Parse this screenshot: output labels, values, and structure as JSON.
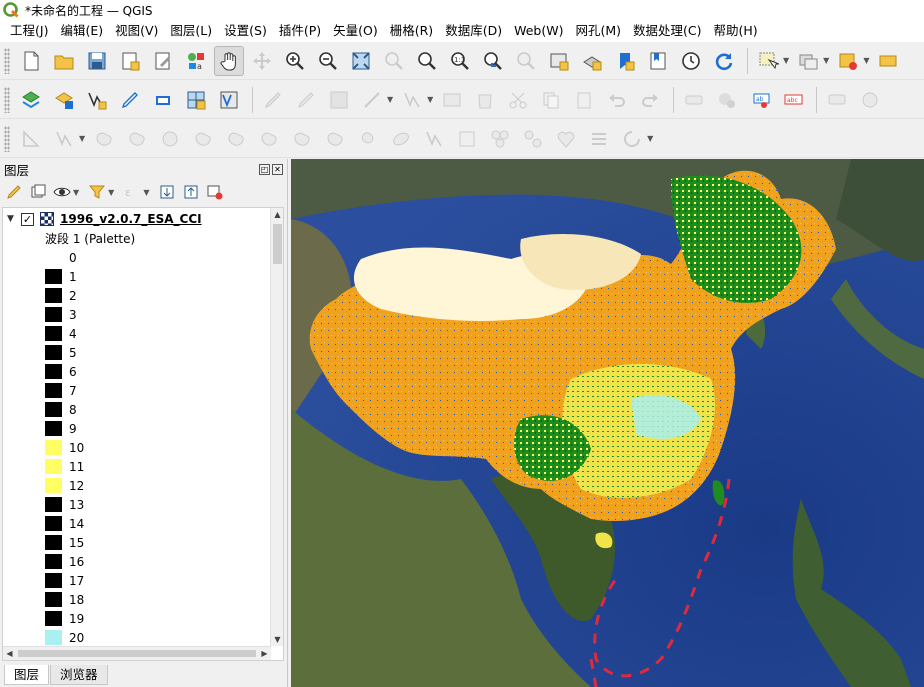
{
  "window": {
    "title": "*未命名的工程 — QGIS"
  },
  "menubar": {
    "items": [
      "工程(J)",
      "编辑(E)",
      "视图(V)",
      "图层(L)",
      "设置(S)",
      "插件(P)",
      "矢量(O)",
      "栅格(R)",
      "数据库(D)",
      "Web(W)",
      "网孔(M)",
      "数据处理(C)",
      "帮助(H)"
    ]
  },
  "layers_panel": {
    "title": "图层",
    "layer": {
      "name": "1996_v2.0.7_ESA_CCI",
      "checked": "✓",
      "expand": "▼"
    },
    "band_label": "波段 1 (Palette)",
    "legend": [
      {
        "value": "0",
        "color": "#ffffff"
      },
      {
        "value": "1",
        "color": "#000000"
      },
      {
        "value": "2",
        "color": "#000000"
      },
      {
        "value": "3",
        "color": "#000000"
      },
      {
        "value": "4",
        "color": "#000000"
      },
      {
        "value": "5",
        "color": "#000000"
      },
      {
        "value": "6",
        "color": "#000000"
      },
      {
        "value": "7",
        "color": "#000000"
      },
      {
        "value": "8",
        "color": "#000000"
      },
      {
        "value": "9",
        "color": "#000000"
      },
      {
        "value": "10",
        "color": "#ffff64"
      },
      {
        "value": "11",
        "color": "#ffff64"
      },
      {
        "value": "12",
        "color": "#ffff64"
      },
      {
        "value": "13",
        "color": "#000000"
      },
      {
        "value": "14",
        "color": "#000000"
      },
      {
        "value": "15",
        "color": "#000000"
      },
      {
        "value": "16",
        "color": "#000000"
      },
      {
        "value": "17",
        "color": "#000000"
      },
      {
        "value": "18",
        "color": "#000000"
      },
      {
        "value": "19",
        "color": "#000000"
      },
      {
        "value": "20",
        "color": "#aaf0f0"
      }
    ]
  },
  "bottom_tabs": [
    "图层",
    "浏览器"
  ],
  "colors": {
    "accent_orange": "#f0a21e",
    "landcover_yellow": "#ffff64",
    "landcover_green": "#1e8c1e",
    "landcover_cyan": "#aaf0f0",
    "bare_cream": "#fff5d7",
    "dash_line": "#e02a3c"
  }
}
